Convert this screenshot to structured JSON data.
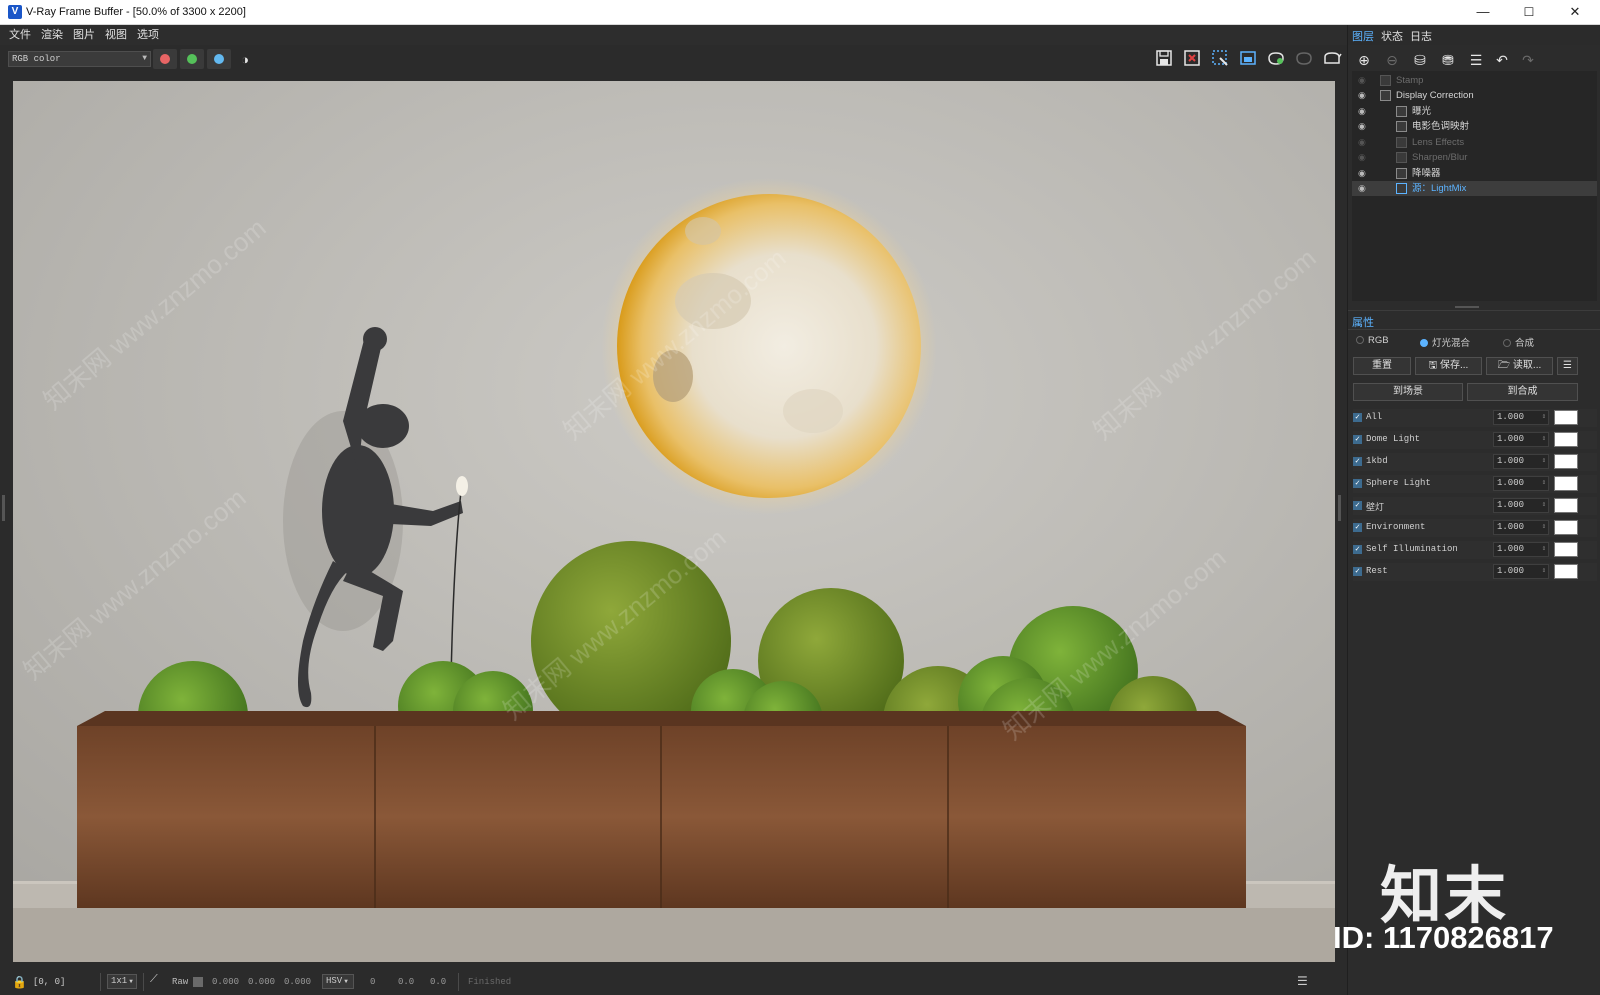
{
  "window": {
    "title": "V-Ray Frame Buffer - [50.0% of 3300 x 2200]",
    "minimize": "—",
    "maximize": "☐",
    "close": "✕"
  },
  "menu": [
    "文件",
    "渲染",
    "图片",
    "视图",
    "选项"
  ],
  "toolbar": {
    "channel": "RGB color",
    "channel_colors": {
      "red": "#e86565",
      "green": "#55c15a",
      "blue": "#63b9f0"
    },
    "icons": [
      "save-icon",
      "clear-icon",
      "region-icon",
      "track-icon",
      "render-icon",
      "render-interactive-icon",
      "teapot-icon"
    ]
  },
  "panel": {
    "tabs": [
      "图层",
      "状态",
      "日志"
    ],
    "tool_icons": [
      "add-layer-icon",
      "remove-layer-icon",
      "save-layers-icon",
      "load-layers-icon",
      "layer-list-icon",
      "undo-icon",
      "redo-icon"
    ],
    "layers": [
      {
        "name": "Stamp",
        "enabled": false
      },
      {
        "name": "Display Correction",
        "enabled": true
      },
      {
        "name": "曝光",
        "enabled": true
      },
      {
        "name": "电影色调映射",
        "enabled": true
      },
      {
        "name": "Lens Effects",
        "enabled": false
      },
      {
        "name": "Sharpen/Blur",
        "enabled": false
      },
      {
        "name": "降噪器",
        "enabled": true
      },
      {
        "name": "源：LightMix",
        "enabled": true,
        "selected": true
      }
    ],
    "properties_title": "属性",
    "modes": [
      "RGB",
      "灯光混合",
      "合成"
    ],
    "selected_mode": "灯光混合",
    "buttons": {
      "reset": "重置",
      "save": "保存...",
      "load": "读取...",
      "to_scene": "到场景",
      "to_composite": "到合成"
    },
    "lightmix": [
      {
        "name": "All",
        "value": "1.000"
      },
      {
        "name": "Dome Light",
        "value": "1.000"
      },
      {
        "name": "1kbd",
        "value": "1.000"
      },
      {
        "name": "Sphere Light",
        "value": "1.000"
      },
      {
        "name": "壁灯",
        "value": "1.000"
      },
      {
        "name": "Environment",
        "value": "1.000"
      },
      {
        "name": "Self Illumination",
        "value": "1.000"
      },
      {
        "name": "Rest",
        "value": "1.000"
      }
    ]
  },
  "status": {
    "coords": "[0, 0]",
    "zoom": "1x1",
    "raw_label": "Raw",
    "r": "0.000",
    "g": "0.000",
    "b": "0.000",
    "color_space": "HSV",
    "h": "0",
    "s": "0.0",
    "v": "0.0",
    "state": "Finished"
  },
  "watermark": {
    "brand": "知末",
    "id": "ID: 1170826817",
    "site": "知末网 www.znzmo.com"
  }
}
